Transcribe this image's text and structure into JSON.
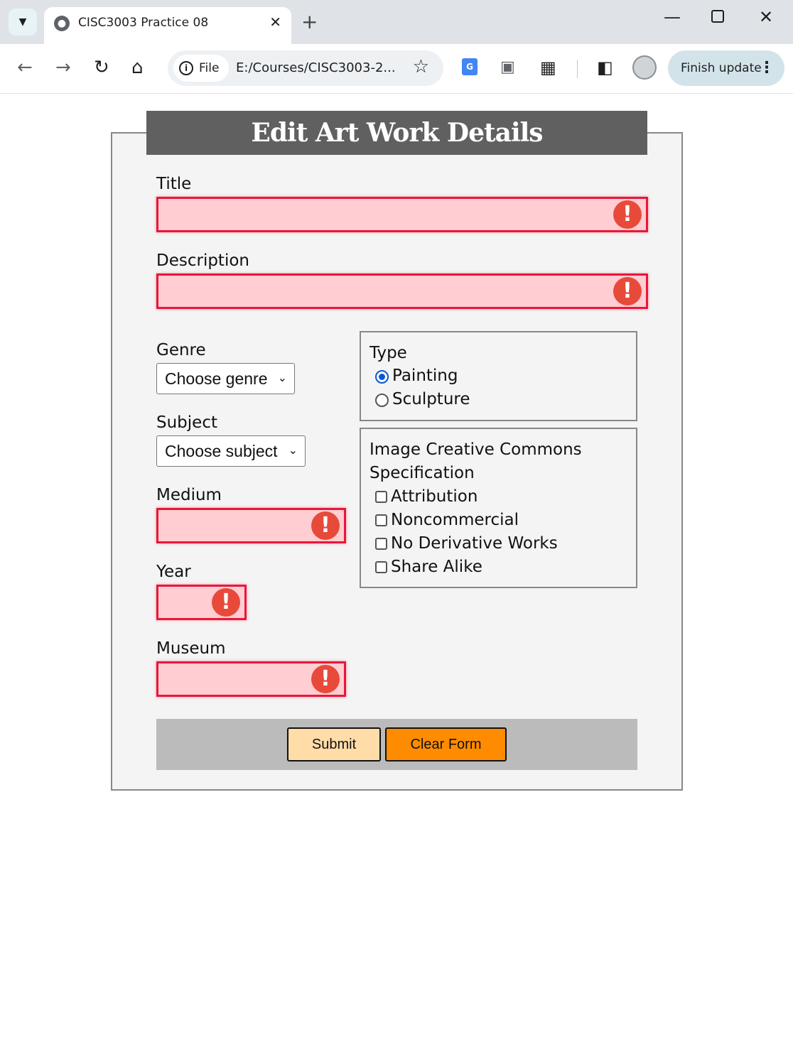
{
  "browser": {
    "tab_title": "CISC3003 Practice 08",
    "omnibox_chip": "File",
    "url": "E:/Courses/CISC3003-2...",
    "update_button": "Finish update"
  },
  "form": {
    "heading": "Edit Art Work Details",
    "fields": {
      "title_label": "Title",
      "description_label": "Description",
      "genre_label": "Genre",
      "genre_selected": "Choose genre",
      "subject_label": "Subject",
      "subject_selected": "Choose subject",
      "medium_label": "Medium",
      "year_label": "Year",
      "museum_label": "Museum"
    },
    "type_group": {
      "legend": "Type",
      "options": [
        "Painting",
        "Sculpture"
      ],
      "selected": "Painting"
    },
    "license_group": {
      "legend_line1": "Image Creative Commons",
      "legend_line2": "Specification",
      "options": [
        "Attribution",
        "Noncommercial",
        "No Derivative Works",
        "Share Alike"
      ]
    },
    "buttons": {
      "submit": "Submit",
      "clear": "Clear Form"
    },
    "error_icon_glyph": "!"
  },
  "colors": {
    "invalid_bg": "#ffcdd2",
    "invalid_border": "#e8173a",
    "error_icon": "#e84a3a",
    "heading_bg": "#606060",
    "submit_bg": "#ffdca8",
    "clear_bg": "#ff8c00"
  }
}
